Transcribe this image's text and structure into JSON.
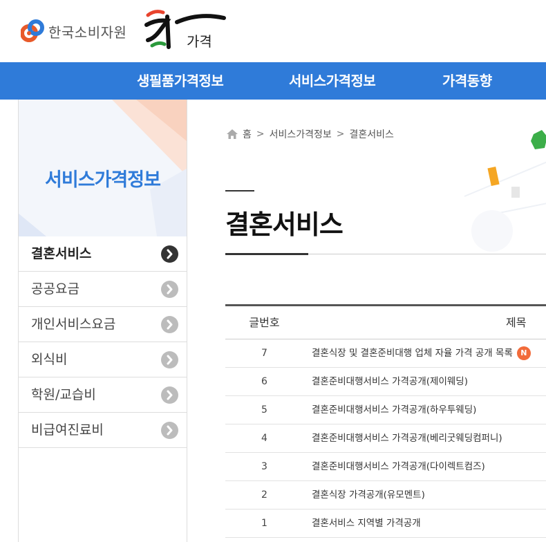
{
  "header": {
    "org_name": "한국소비자원",
    "brand_text": "가격"
  },
  "nav": {
    "items": [
      "생필품가격정보",
      "서비스가격정보",
      "가격동향"
    ]
  },
  "sidebar": {
    "title": "서비스가격정보",
    "items": [
      {
        "label": "결혼서비스",
        "active": true
      },
      {
        "label": "공공요금",
        "active": false
      },
      {
        "label": "개인서비스요금",
        "active": false
      },
      {
        "label": "외식비",
        "active": false
      },
      {
        "label": "학원/교습비",
        "active": false
      },
      {
        "label": "비급여진료비",
        "active": false
      }
    ]
  },
  "breadcrumb": {
    "home": "홈",
    "level1": "서비스가격정보",
    "level2": "결혼서비스"
  },
  "page": {
    "title": "결혼서비스"
  },
  "board": {
    "headers": {
      "no": "글번호",
      "title": "제목"
    },
    "rows": [
      {
        "no": "7",
        "title": "결혼식장 및 결혼준비대행 업체 자율 가격 공개 목록",
        "badge": "N"
      },
      {
        "no": "6",
        "title": "결혼준비대행서비스 가격공개(제이웨딩)"
      },
      {
        "no": "5",
        "title": "결혼준비대행서비스 가격공개(하우투웨딩)"
      },
      {
        "no": "4",
        "title": "결혼준비대행서비스 가격공개(베리굿웨딩컴퍼니)"
      },
      {
        "no": "3",
        "title": "결혼준비대행서비스 가격공개(다이렉트컴즈)"
      },
      {
        "no": "2",
        "title": "결혼식장 가격공개(유모멘트)"
      },
      {
        "no": "1",
        "title": "결혼서비스 지역별 가격공개"
      }
    ]
  },
  "colors": {
    "primary": "#2f7bd9",
    "badge": "#f26b3a"
  }
}
